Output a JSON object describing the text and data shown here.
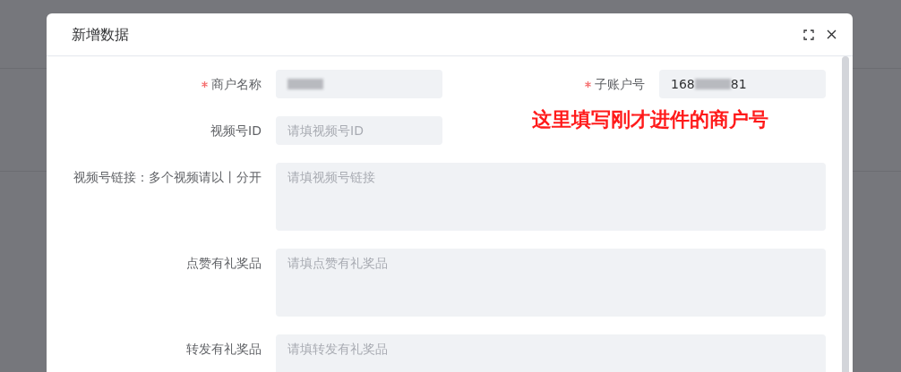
{
  "dialog": {
    "title": "新增数据",
    "fields": [
      {
        "kind": "input",
        "label": "商户名称",
        "required": true,
        "redacted": true
      },
      {
        "kind": "input",
        "label": "子账户号",
        "required": true,
        "value_start": "168",
        "value_end": "81",
        "redacted": true
      },
      {
        "kind": "input",
        "label": "视频号ID",
        "required": false,
        "placeholder": "请填视频号ID"
      },
      {
        "kind": "textarea",
        "label": "视频号链接：多个视频请以丨分开",
        "required": false,
        "placeholder": "请填视频号链接"
      },
      {
        "kind": "textarea",
        "label": "点赞有礼奖品",
        "required": false,
        "placeholder": "请填点赞有礼奖品"
      },
      {
        "kind": "textarea",
        "label": "转发有礼奖品",
        "required": false,
        "placeholder": "请填转发有礼奖品"
      }
    ],
    "annotation": "这里填写刚才进件的商户号"
  }
}
